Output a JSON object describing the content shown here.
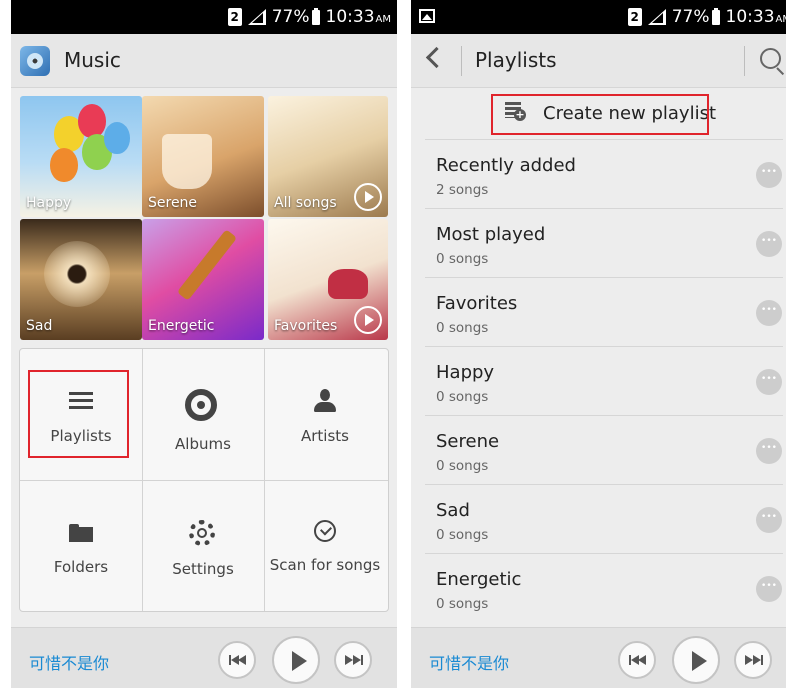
{
  "status_bar": {
    "battery": "77%",
    "time": "10:33",
    "ampm": "AM",
    "sim": "2"
  },
  "left": {
    "header_title": "Music",
    "tiles": [
      {
        "label": "Happy",
        "play": false
      },
      {
        "label": "Serene",
        "play": false
      },
      {
        "label": "All songs",
        "play": true
      },
      {
        "label": "Sad",
        "play": false
      },
      {
        "label": "Energetic",
        "play": false
      },
      {
        "label": "Favorites",
        "play": true
      }
    ],
    "menu": [
      {
        "label": "Playlists",
        "icon": "list-icon"
      },
      {
        "label": "Albums",
        "icon": "album-icon"
      },
      {
        "label": "Artists",
        "icon": "artist-icon"
      },
      {
        "label": "Folders",
        "icon": "folder-icon"
      },
      {
        "label": "Settings",
        "icon": "settings-icon"
      },
      {
        "label": "Scan for songs",
        "icon": "scan-icon"
      }
    ]
  },
  "right": {
    "header_title": "Playlists",
    "create_label": "Create new playlist",
    "playlists": [
      {
        "name": "Recently added",
        "count": "2 songs"
      },
      {
        "name": "Most played",
        "count": "0 songs"
      },
      {
        "name": "Favorites",
        "count": "0 songs"
      },
      {
        "name": "Happy",
        "count": "0 songs"
      },
      {
        "name": "Serene",
        "count": "0 songs"
      },
      {
        "name": "Sad",
        "count": "0 songs"
      },
      {
        "name": "Energetic",
        "count": "0 songs"
      }
    ]
  },
  "player": {
    "now_playing": "可惜不是你"
  },
  "colors": {
    "accent": "#1a8ad3",
    "highlight": "#e0242c",
    "background": "#ededed"
  }
}
